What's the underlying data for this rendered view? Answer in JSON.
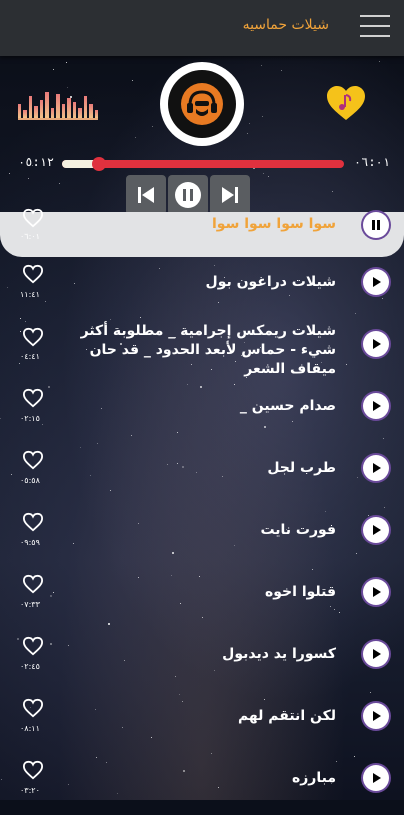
{
  "app": {
    "title": "شيلات حماسيه"
  },
  "player": {
    "current_time": "٠٥:١٢",
    "total_time": "٠٦:٠١",
    "progress": 0.13
  },
  "icons": {
    "menu": "hamburger-icon",
    "equalizer": "equalizer-icon",
    "logo": "dj-headphones-logo",
    "favorite": "heart-music-icon",
    "prev": "skip-previous-icon",
    "pause": "pause-icon",
    "next": "skip-next-icon",
    "play": "play-icon",
    "heart": "heart-outline-icon"
  },
  "colors": {
    "accent": "#f0a33a",
    "progress": "#e0313e",
    "appbar": "#2c2f33"
  },
  "tracks": [
    {
      "title": "سوا سوا سوا سوا",
      "duration": "٠٦:٠١",
      "active": true
    },
    {
      "title": "شيلات دراغون بول",
      "duration": "١١:٤١"
    },
    {
      "title": "شيلات ريمكس إجرامية _ مطلوبة أكثر شيء - حماس لأبعد الحدود _ قد حان ميقاف الشعر",
      "duration": "٠٤:٤١"
    },
    {
      "title": "صدام حسين _",
      "duration": "٠٢:١٥"
    },
    {
      "title": "طرب لجل",
      "duration": "٠٥:٥٨"
    },
    {
      "title": "فورت نايت",
      "duration": "٠٩:٥٩"
    },
    {
      "title": "قتلوا اخوه",
      "duration": "٠٧:٣٣"
    },
    {
      "title": "كسورا يد ديدبول",
      "duration": "٠٢:٤٥"
    },
    {
      "title": "لكن انتقم لهم",
      "duration": "٠٨:١١"
    },
    {
      "title": "مبارزه",
      "duration": "٠٣:٢٠"
    }
  ]
}
